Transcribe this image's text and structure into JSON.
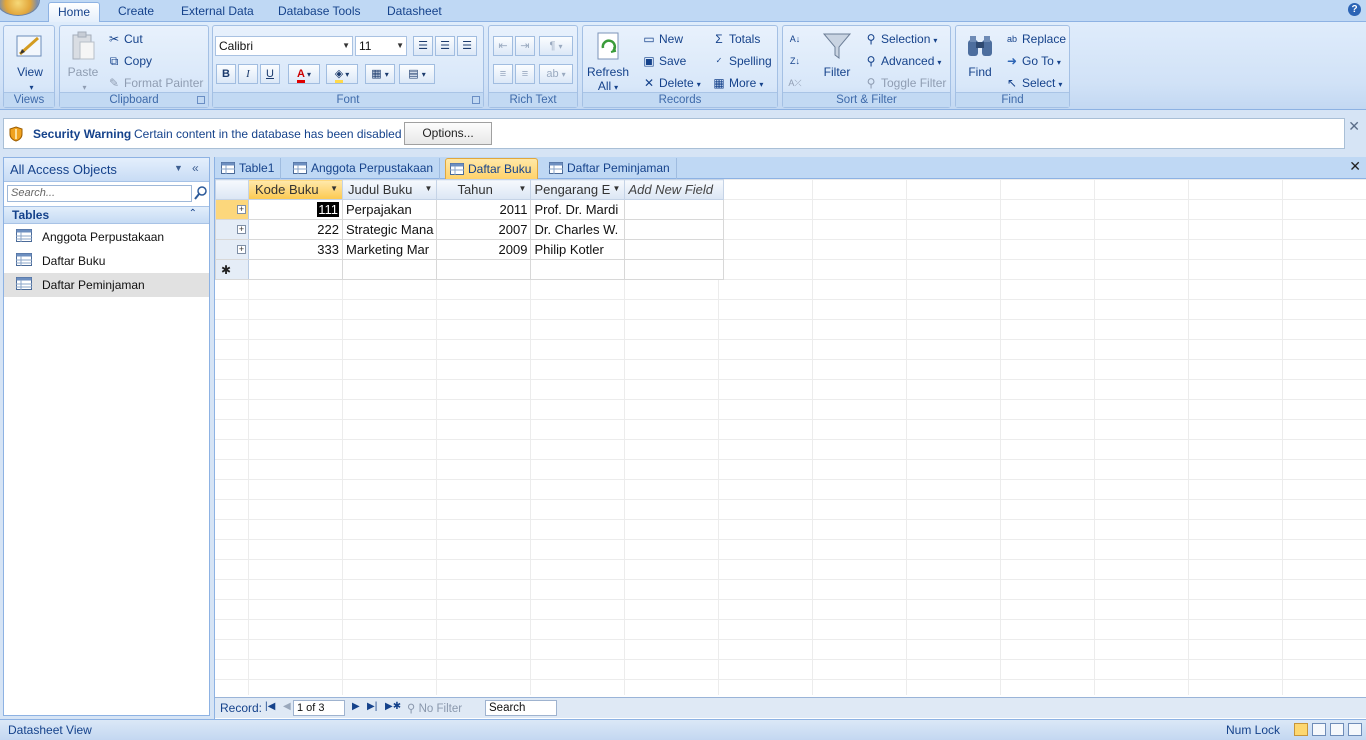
{
  "ribbon": {
    "tabs": [
      "Home",
      "Create",
      "External Data",
      "Database Tools",
      "Datasheet"
    ],
    "active_tab": "Home",
    "views": {
      "view_label": "View",
      "group_label": "Views"
    },
    "clipboard": {
      "paste": "Paste",
      "cut": "Cut",
      "copy": "Copy",
      "format_painter": "Format Painter",
      "group_label": "Clipboard"
    },
    "font": {
      "family": "Calibri",
      "size": "11",
      "bold": "B",
      "italic": "I",
      "underline": "U",
      "group_label": "Font"
    },
    "rich_text": {
      "group_label": "Rich Text"
    },
    "records": {
      "refresh": "Refresh",
      "refresh_all": "All",
      "new": "New",
      "save": "Save",
      "delete": "Delete",
      "totals": "Totals",
      "spelling": "Spelling",
      "more": "More",
      "group_label": "Records"
    },
    "sort_filter": {
      "filter": "Filter",
      "selection": "Selection",
      "advanced": "Advanced",
      "toggle_filter": "Toggle Filter",
      "group_label": "Sort & Filter"
    },
    "find": {
      "find": "Find",
      "replace": "Replace",
      "goto": "Go To",
      "select": "Select",
      "group_label": "Find"
    }
  },
  "security_bar": {
    "title": "Security Warning",
    "message": "Certain content in the database has been disabled",
    "options_label": "Options..."
  },
  "nav_pane": {
    "title": "All Access Objects",
    "search_placeholder": "Search...",
    "section": "Tables",
    "items": [
      "Anggota Perpustakaan",
      "Daftar Buku",
      "Daftar Peminjaman"
    ],
    "selected_item": "Daftar Peminjaman"
  },
  "doc_tabs": {
    "tabs": [
      "Table1",
      "Anggota Perpustakaan",
      "Daftar Buku",
      "Daftar Peminjaman"
    ],
    "active": "Daftar Buku"
  },
  "datasheet": {
    "columns": [
      "Kode Buku",
      "Judul Buku",
      "Tahun",
      "Pengarang E",
      "Add New Field"
    ],
    "rows": [
      [
        "111",
        "Perpajakan",
        "2011",
        "Prof. Dr. Mardi"
      ],
      [
        "222",
        "Strategic Mana",
        "2007",
        "Dr. Charles W."
      ],
      [
        "333",
        "Marketing Mar",
        "2009",
        "Philip Kotler"
      ]
    ]
  },
  "record_nav": {
    "label": "Record:",
    "position": "1 of 3",
    "filter_state": "No Filter",
    "search_label": "Search"
  },
  "status_bar": {
    "view": "Datasheet View",
    "num_lock": "Num Lock"
  },
  "colors": {
    "ribbon_bg": "#dfecfb",
    "active_doc_tab": "#ffd26a",
    "selected_header": "#fcc94f",
    "brand_text": "#15428b"
  }
}
